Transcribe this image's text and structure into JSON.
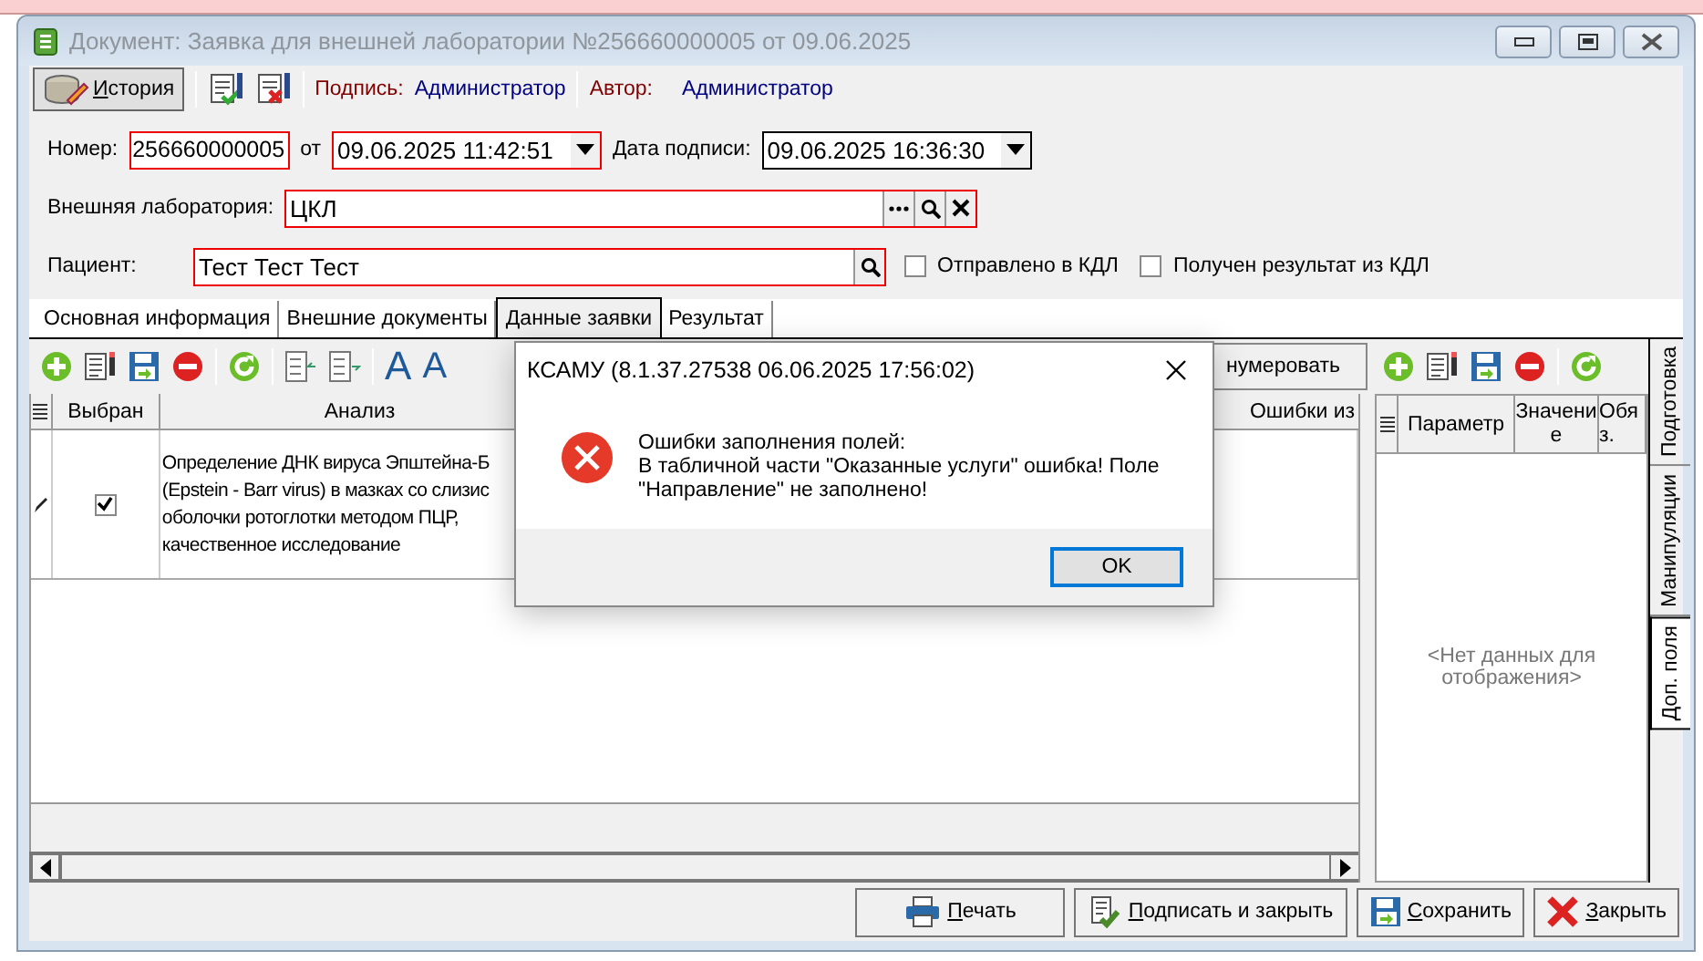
{
  "window": {
    "title": "Документ: Заявка для внешней лаборатории №256660000005 от 09.06.2025"
  },
  "toolbar": {
    "history_button": "История",
    "signature_label": "Подпись:",
    "signature_value": "Администратор",
    "author_label": "Автор:",
    "author_value": "Администратор"
  },
  "form": {
    "number": {
      "label": "Номер:",
      "value": "256660000005",
      "invalid": true
    },
    "date": {
      "label": "от",
      "value": "09.06.2025 11:42:51",
      "invalid": true
    },
    "sign_date": {
      "label": "Дата подписи:",
      "value": "09.06.2025 16:36:30",
      "invalid": false
    },
    "lab": {
      "label": "Внешняя лаборатория:",
      "value": "ЦКЛ",
      "invalid": true
    },
    "patient": {
      "label": "Пациент:",
      "value": "Тест Тест Тест",
      "invalid": true
    },
    "flags": [
      {
        "label": "Отправлено в КДЛ",
        "checked": false
      },
      {
        "label": "Получен результат из КДЛ",
        "checked": false
      }
    ]
  },
  "tabs": [
    {
      "label": "Основная информация",
      "selected": false
    },
    {
      "label": "Внешние документы",
      "selected": false
    },
    {
      "label": "Данные заявки",
      "selected": true
    },
    {
      "label": "Результат",
      "selected": false
    }
  ],
  "grid_toolbar": {
    "font_larger": "A",
    "font_smaller": "A",
    "renumber_button": "нумеровать"
  },
  "grid": {
    "columns": [
      "Выбран",
      "Анализ",
      "Ошибки из"
    ],
    "rows": [
      {
        "checked": true,
        "analysis": "Определение ДНК вируса Эпштейна-Б\n(Epstein - Barr virus) в мазках со слизис\nоболочки ротоглотки методом ПЦР,\nкачественное исследование"
      }
    ]
  },
  "side_panel": {
    "columns": [
      "Параметр",
      "Значение",
      "Обяз."
    ],
    "empty_text": "<Нет данных для отображения>"
  },
  "side_tabs": [
    {
      "label": "Подготовка",
      "selected": false
    },
    {
      "label": "Манипуляции",
      "selected": false
    },
    {
      "label": "Доп. поля",
      "selected": true
    }
  ],
  "buttons": [
    {
      "kind": "print",
      "label": "Печать"
    },
    {
      "kind": "sign",
      "label": "Подписать и закрыть"
    },
    {
      "kind": "save",
      "label": "Сохранить"
    },
    {
      "kind": "close",
      "label": "Закрыть"
    }
  ],
  "dialog": {
    "title": "КСАМУ (8.1.37.27538 06.06.2025 17:56:02)",
    "message": "Ошибки заполнения полей:\nВ табличной части \"Оказанные услуги\" ошибка! Поле\n\"Направление\" не заполнено!",
    "ok_button": "OK"
  }
}
